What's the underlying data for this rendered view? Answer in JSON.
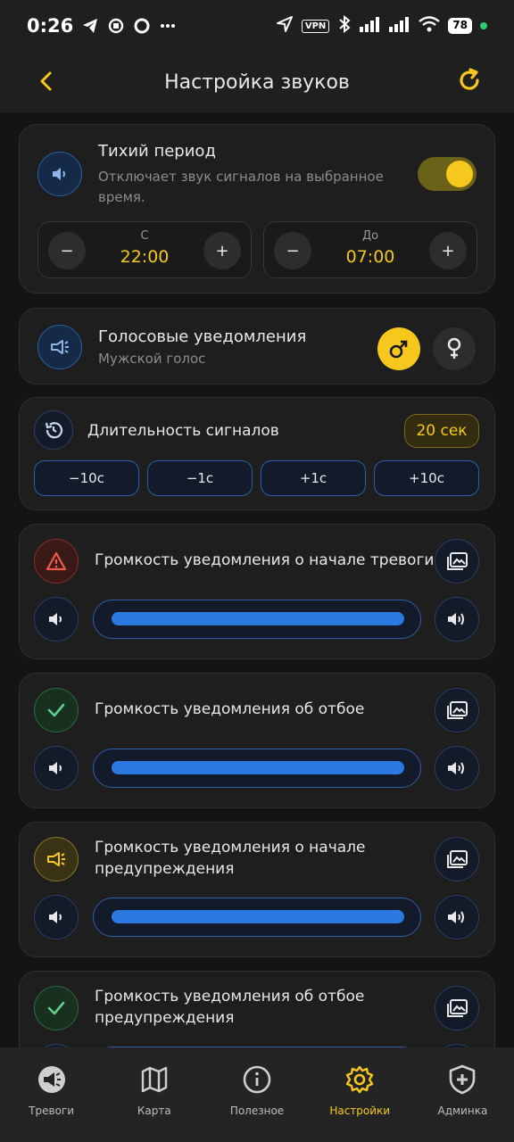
{
  "status": {
    "time": "0:26",
    "vpn": "VPN",
    "battery": "78"
  },
  "appbar": {
    "title": "Настройка звуков"
  },
  "quiet": {
    "title": "Тихий период",
    "desc_line1": "Отключает звук сигналов на выбранное",
    "desc_line2": "время.",
    "enabled": true,
    "from_label": "С",
    "from_value": "22:00",
    "to_label": "До",
    "to_value": "07:00",
    "minus": "−",
    "plus": "+"
  },
  "voice": {
    "title": "Голосовые уведомления",
    "subtitle": "Мужской голос",
    "selected": "male"
  },
  "duration": {
    "title": "Длительность сигналов",
    "value": "20 сек",
    "steps": [
      "−10с",
      "−1с",
      "+1с",
      "+10с"
    ]
  },
  "volumes": [
    {
      "line1": "Громкость уведомления о начале тревоги",
      "line2": "",
      "icon": "warning-icon",
      "level": 1.0
    },
    {
      "line1": "Громкость уведомления об отбое",
      "line2": "",
      "icon": "check-icon",
      "level": 1.0
    },
    {
      "line1": "Громкость уведомления о начале",
      "line2": "предупреждения",
      "icon": "megaphone-icon",
      "level": 1.0
    },
    {
      "line1": "Громкость уведомления об отбое",
      "line2": "предупреждения",
      "icon": "check-icon",
      "level": 1.0
    }
  ],
  "nav": [
    {
      "label": "Тревоги",
      "icon": "megaphone-icon",
      "active": false
    },
    {
      "label": "Карта",
      "icon": "map-icon",
      "active": false
    },
    {
      "label": "Полезное",
      "icon": "info-icon",
      "active": false
    },
    {
      "label": "Настройки",
      "icon": "gear-icon",
      "active": true
    },
    {
      "label": "Админка",
      "icon": "shield-icon",
      "active": false
    }
  ],
  "colors": {
    "accent": "#f6c81e",
    "blue": "#2a7ae2",
    "card": "#1e1e1e",
    "bg": "#141414"
  }
}
